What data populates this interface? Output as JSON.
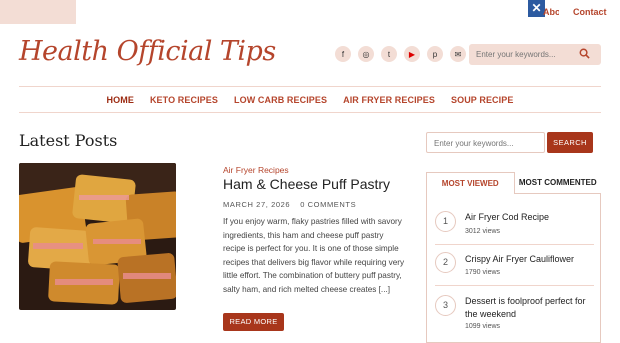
{
  "top_links": {
    "about": "About",
    "contact": "Contact"
  },
  "ad_close": "✕",
  "logo": "Health Official Tips",
  "social": [
    {
      "icon": "facebook-icon",
      "glyph": "f"
    },
    {
      "icon": "instagram-icon",
      "glyph": "◎"
    },
    {
      "icon": "twitter-icon",
      "glyph": "t"
    },
    {
      "icon": "youtube-icon",
      "glyph": "▶"
    },
    {
      "icon": "pinterest-icon",
      "glyph": "p"
    },
    {
      "icon": "email-icon",
      "glyph": "✉"
    }
  ],
  "header_search": {
    "placeholder": "Enter your keywords..."
  },
  "nav": [
    "HOME",
    "KETO RECIPES",
    "LOW CARB RECIPES",
    "AIR FRYER RECIPES",
    "SOUP RECIPE"
  ],
  "latest": {
    "title": "Latest Posts"
  },
  "post": {
    "category": "Air Fryer Recipes",
    "title": "Ham & Cheese Puff Pastry",
    "date": "MARCH 27, 2026",
    "comments": "0 COMMENTS",
    "excerpt": "If you enjoy warm, flaky pastries filled with savory ingredients, this ham and cheese puff pastry recipe is perfect for you. It is one of those simple recipes that delivers big flavor while requiring very little effort. The combination of buttery puff pastry, salty ham, and rich melted cheese creates [...]",
    "read_more": "READ MORE"
  },
  "sidebar": {
    "search_placeholder": "Enter your keywords...",
    "search_button": "SEARCH",
    "tabs": [
      "MOST VIEWED",
      "MOST COMMENTED"
    ],
    "items": [
      {
        "num": "1",
        "title": "Air Fryer Cod Recipe",
        "views": "3012 views"
      },
      {
        "num": "2",
        "title": "Crispy Air Fryer Cauliflower",
        "views": "1790 views"
      },
      {
        "num": "3",
        "title": "Dessert is foolproof perfect for the weekend",
        "views": "1099 views"
      }
    ]
  },
  "colors": {
    "accent": "#b5452c",
    "button": "#a8361b",
    "light": "#f3ddd5"
  }
}
